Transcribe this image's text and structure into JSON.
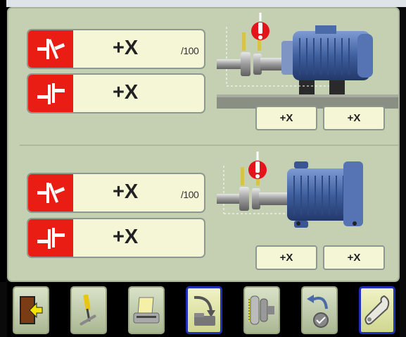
{
  "upper_panel": {
    "angle_reading": {
      "value": "+X",
      "unit": "/100",
      "icon": "angularity-icon"
    },
    "offset_reading": {
      "value": "+X",
      "icon": "offset-icon"
    },
    "foot_front_label": "+X",
    "foot_rear_label": "+X",
    "motor_view": "side-view"
  },
  "lower_panel": {
    "angle_reading": {
      "value": "+X",
      "unit": "/100",
      "icon": "angularity-icon"
    },
    "offset_reading": {
      "value": "+X",
      "icon": "offset-icon"
    },
    "foot_front_label": "+X",
    "foot_rear_label": "+X",
    "motor_view": "top-view"
  },
  "colors": {
    "panel": "#c5d0b3",
    "value_field": "#f5f6d6",
    "symbol_red": "#ea1d14",
    "selected_border": "#1f31b8",
    "motor_blue": "#4a6aa8"
  },
  "toolbar": {
    "buttons": [
      {
        "icon": "exit-door-icon",
        "selected": false
      },
      {
        "icon": "tools-icon",
        "selected": false
      },
      {
        "icon": "printer-icon",
        "selected": false
      },
      {
        "icon": "save-to-folder-icon",
        "selected": true
      },
      {
        "icon": "coupling-icon",
        "selected": false
      },
      {
        "icon": "undo-measure-icon",
        "selected": false
      },
      {
        "icon": "wrench-icon",
        "selected": true
      }
    ]
  }
}
